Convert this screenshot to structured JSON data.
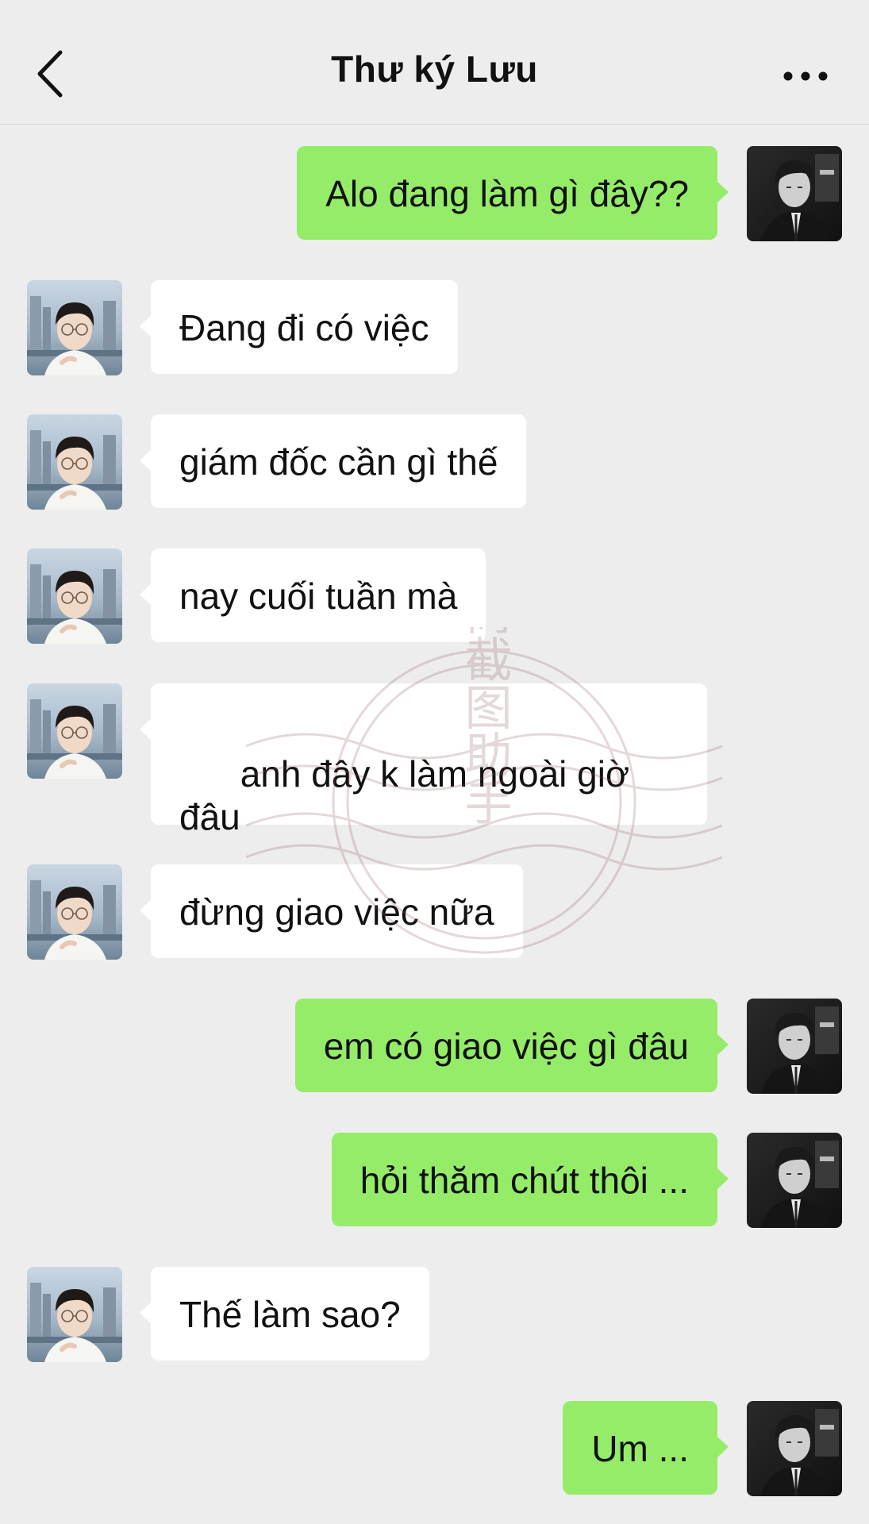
{
  "header": {
    "title": "Thư ký Lưu",
    "back_icon": "chevron-left-icon",
    "more_icon": "more-dots-icon"
  },
  "colors": {
    "background": "#ededed",
    "sent_bubble": "#95ec69",
    "received_bubble": "#ffffff",
    "text": "#111111"
  },
  "messages": [
    {
      "side": "sent",
      "text": "Alo đang làm gì đây??"
    },
    {
      "side": "received",
      "text": "Đang đi có việc"
    },
    {
      "side": "received",
      "text": "giám đốc cần gì thế"
    },
    {
      "side": "received",
      "text": "nay cuối tuần mà"
    },
    {
      "side": "received",
      "text": "anh đây k làm ngoài giờ đâu",
      "emoji": "ok-hand-emoji"
    },
    {
      "side": "received",
      "text": "đừng giao việc nữa"
    },
    {
      "side": "sent",
      "text": "em có giao việc gì đâu"
    },
    {
      "side": "sent",
      "text": "hỏi thăm chút thôi ..."
    },
    {
      "side": "received",
      "text": "Thế làm sao?"
    },
    {
      "side": "sent",
      "text": "Um ..."
    }
  ],
  "watermark": {
    "text": "微商截图助手"
  }
}
